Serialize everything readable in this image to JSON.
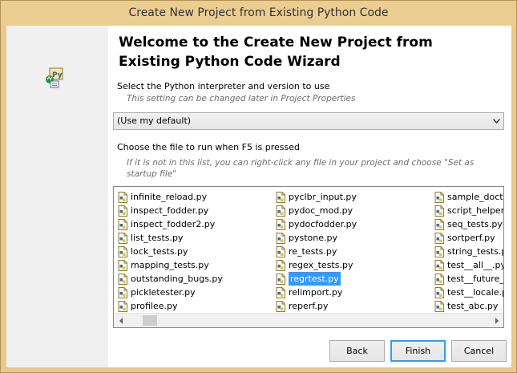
{
  "window": {
    "title": "Create New Project from Existing Python Code"
  },
  "wizard": {
    "heading": "Welcome to the Create New Project from Existing Python Code Wizard",
    "icon": "python-project-icon"
  },
  "interpreter": {
    "label": "Select the Python interpreter and version to use",
    "hint": "This setting can be changed later in Project Properties",
    "selected": "(Use my default)"
  },
  "startup": {
    "label": "Choose the file to run when F5 is pressed",
    "hint": "If it is not in this list, you can right-click any file in your project and choose \"Set as startup file\""
  },
  "files": {
    "icon": "python-file-icon",
    "selected": "regrtest.py",
    "columns": [
      [
        "infinite_reload.py",
        "inspect_fodder.py",
        "inspect_fodder2.py",
        "list_tests.py",
        "lock_tests.py",
        "mapping_tests.py",
        "outstanding_bugs.py",
        "pickletester.py",
        "profilee.py"
      ],
      [
        "pyclbr_input.py",
        "pydoc_mod.py",
        "pydocfodder.py",
        "pystone.py",
        "re_tests.py",
        "regex_tests.py",
        "regrtest.py",
        "relimport.py",
        "reperf.py"
      ],
      [
        "sample_docte",
        "script_helper.",
        "seq_tests.py",
        "sortperf.py",
        "string_tests.p",
        "test__all__.py",
        "test__future_",
        "test__locale.p",
        "test_abc.py"
      ]
    ]
  },
  "buttons": {
    "back": "Back",
    "finish": "Finish",
    "cancel": "Cancel"
  }
}
